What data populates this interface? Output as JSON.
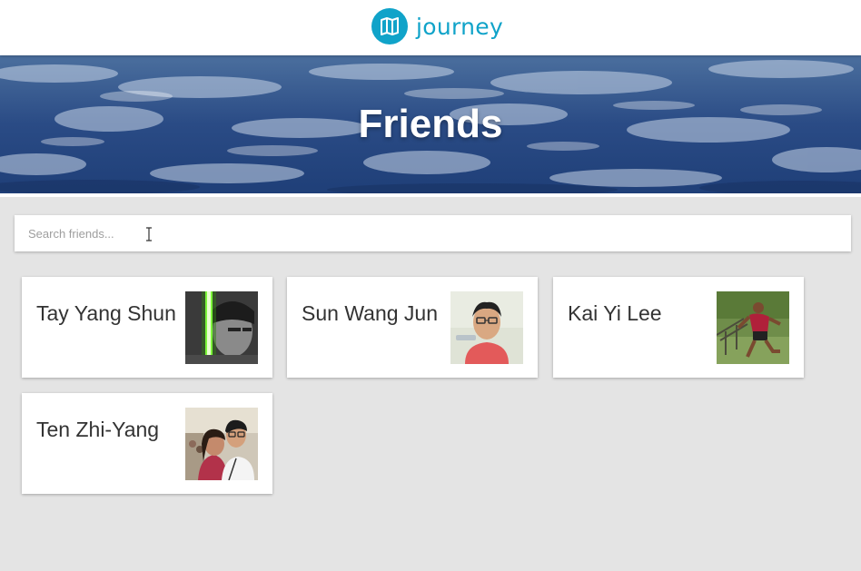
{
  "header": {
    "brand_name": "journey",
    "brand_color": "#10a3c9"
  },
  "hero": {
    "title": "Friends"
  },
  "search": {
    "placeholder": "Search friends...",
    "value": ""
  },
  "friends": [
    {
      "name": "Tay Yang Shun",
      "photo_icon": "avatar-lightsaber-portrait"
    },
    {
      "name": "Sun Wang Jun",
      "photo_icon": "avatar-glasses-portrait"
    },
    {
      "name": "Kai Yi Lee",
      "photo_icon": "avatar-running-outdoor"
    },
    {
      "name": "Ten Zhi-Yang",
      "photo_icon": "avatar-couple-selfie"
    }
  ]
}
